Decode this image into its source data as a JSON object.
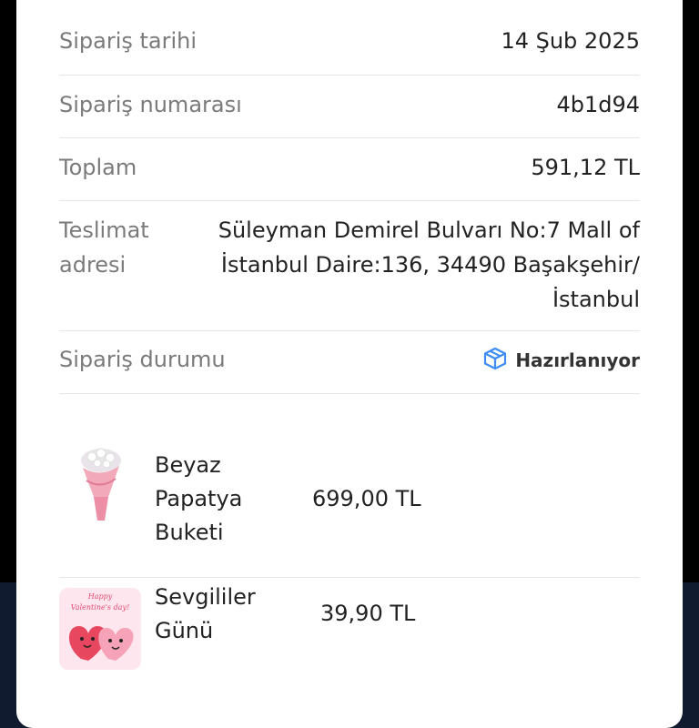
{
  "order": {
    "date_label": "Sipariş tarihi",
    "date_value": "14 Şub 2025",
    "number_label": "Sipariş numarası",
    "number_value": "4b1d94",
    "total_label": "Toplam",
    "total_value": "591,12 TL",
    "address_label_line1": "Teslimat",
    "address_label_line2": "adresi",
    "address_line1": "Süleyman Demirel Bulvarı No:7 Mall of",
    "address_line2": "İstanbul Daire:136, 34490 Başakşehir/",
    "address_line3": "İstanbul",
    "status_label": "Sipariş durumu",
    "status_value": "Hazırlanıyor",
    "status_icon": "box-icon",
    "status_color": "#3d8bf5"
  },
  "products": [
    {
      "name_line1": "Beyaz",
      "name_line2": "Papatya",
      "name_line3": "Buketi",
      "price": "699,00 TL"
    },
    {
      "name_line1": "Sevgililer",
      "name_line2": "Günü",
      "price": "39,90 TL",
      "badge_line1": "Happy",
      "badge_line2": "Valentine's day!"
    }
  ]
}
